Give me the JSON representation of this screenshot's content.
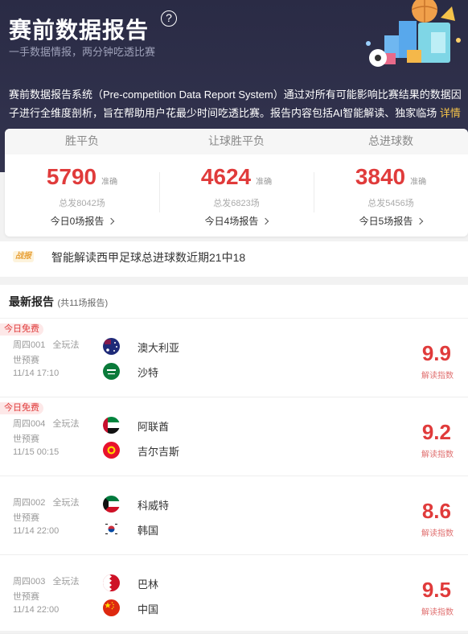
{
  "header": {
    "title": "赛前数据报告",
    "subtitle": "一手数据情报，两分钟吃透比赛",
    "description": "赛前数据报告系统（Pre-competition Data Report System）通过对所有可能影响比赛结果的数据因子进行全维度剖析，旨在帮助用户花最少时间吃透比赛。报告内容包括AI智能解读、独家临场",
    "more_link": "详情>"
  },
  "stats": [
    {
      "label": "胜平负",
      "number": "5790",
      "unit": "准确",
      "total": "总发8042场",
      "today": "今日0场报告"
    },
    {
      "label": "让球胜平负",
      "number": "4624",
      "unit": "准确",
      "total": "总发6823场",
      "today": "今日4场报告"
    },
    {
      "label": "总进球数",
      "number": "3840",
      "unit": "准确",
      "total": "总发5456场",
      "today": "今日5场报告"
    }
  ],
  "ticker": {
    "badge": "战报",
    "text": "智能解读西甲足球总进球数近期21中18"
  },
  "reports_section": {
    "title": "最新报告",
    "count": "(共11场报告)"
  },
  "reports": [
    {
      "free_tag": "今日免费",
      "code": "周四001",
      "play": "全玩法",
      "league": "世预赛",
      "time": "11/14 17:10",
      "home": "澳大利亚",
      "away": "沙特",
      "score": "9.9",
      "score_label": "解读指数",
      "home_flag": "australia-flag-icon",
      "away_flag": "saudi-arabia-flag-icon"
    },
    {
      "free_tag": "今日免费",
      "code": "周四004",
      "play": "全玩法",
      "league": "世预赛",
      "time": "11/15 00:15",
      "home": "阿联酋",
      "away": "吉尔吉斯",
      "score": "9.2",
      "score_label": "解读指数",
      "home_flag": "uae-flag-icon",
      "away_flag": "kyrgyzstan-flag-icon"
    },
    {
      "free_tag": "",
      "code": "周四002",
      "play": "全玩法",
      "league": "世预赛",
      "time": "11/14 22:00",
      "home": "科威特",
      "away": "韩国",
      "score": "8.6",
      "score_label": "解读指数",
      "home_flag": "kuwait-flag-icon",
      "away_flag": "south-korea-flag-icon"
    },
    {
      "free_tag": "",
      "code": "周四003",
      "play": "全玩法",
      "league": "世预赛",
      "time": "11/14 22:00",
      "home": "巴林",
      "away": "中国",
      "score": "9.5",
      "score_label": "解读指数",
      "home_flag": "bahrain-flag-icon",
      "away_flag": "china-flag-icon"
    }
  ],
  "colors": {
    "header_bg": "#2a2b45",
    "accent_red": "#e03b3b",
    "link_yellow": "#f5c34a"
  }
}
